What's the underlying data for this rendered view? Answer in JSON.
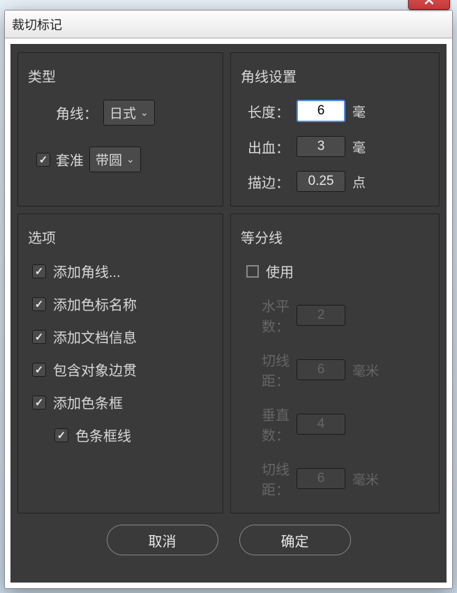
{
  "window": {
    "title": "裁切标记"
  },
  "type_section": {
    "title": "类型",
    "corner_label": "角线：",
    "corner_value": "日式",
    "registration_label": "套准",
    "registration_checked": true,
    "registration_value": "带圆"
  },
  "corner_settings": {
    "title": "角线设置",
    "length_label": "长度：",
    "length_value": "6",
    "length_unit": "毫",
    "bleed_label": "出血：",
    "bleed_value": "3",
    "bleed_unit": "毫",
    "stroke_label": "描边：",
    "stroke_value": "0.25",
    "stroke_unit": "点"
  },
  "options": {
    "title": "选项",
    "items": [
      {
        "label": "添加角线...",
        "checked": true
      },
      {
        "label": "添加色标名称",
        "checked": true
      },
      {
        "label": "添加文档信息",
        "checked": true
      },
      {
        "label": "包含对象边贯",
        "checked": true
      },
      {
        "label": "添加色条框",
        "checked": true
      },
      {
        "label": "色条框线",
        "checked": true,
        "indent": true
      }
    ]
  },
  "division_lines": {
    "title": "等分线",
    "use_label": "使用",
    "use_checked": false,
    "h_count_label": "水平数：",
    "h_count_value": "2",
    "h_gap_label": "切线距：",
    "h_gap_value": "6",
    "h_gap_unit": "毫米",
    "v_count_label": "垂直数：",
    "v_count_value": "4",
    "v_gap_label": "切线距：",
    "v_gap_value": "6",
    "v_gap_unit": "毫米"
  },
  "buttons": {
    "cancel": "取消",
    "ok": "确定"
  }
}
